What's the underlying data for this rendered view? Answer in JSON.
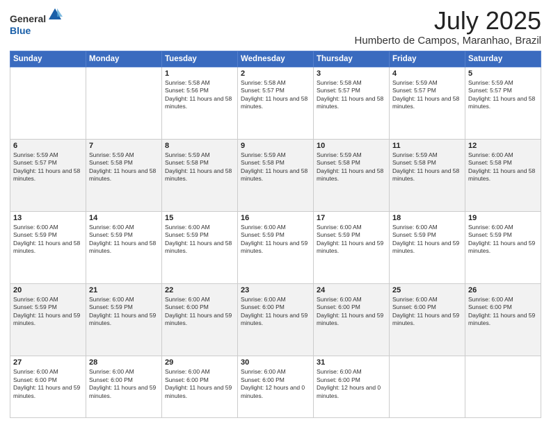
{
  "header": {
    "logo_line1": "General",
    "logo_line2": "Blue",
    "month_year": "July 2025",
    "location": "Humberto de Campos, Maranhao, Brazil"
  },
  "weekdays": [
    "Sunday",
    "Monday",
    "Tuesday",
    "Wednesday",
    "Thursday",
    "Friday",
    "Saturday"
  ],
  "weeks": [
    [
      {
        "day": "",
        "detail": ""
      },
      {
        "day": "",
        "detail": ""
      },
      {
        "day": "1",
        "detail": "Sunrise: 5:58 AM\nSunset: 5:56 PM\nDaylight: 11 hours and 58 minutes."
      },
      {
        "day": "2",
        "detail": "Sunrise: 5:58 AM\nSunset: 5:57 PM\nDaylight: 11 hours and 58 minutes."
      },
      {
        "day": "3",
        "detail": "Sunrise: 5:58 AM\nSunset: 5:57 PM\nDaylight: 11 hours and 58 minutes."
      },
      {
        "day": "4",
        "detail": "Sunrise: 5:59 AM\nSunset: 5:57 PM\nDaylight: 11 hours and 58 minutes."
      },
      {
        "day": "5",
        "detail": "Sunrise: 5:59 AM\nSunset: 5:57 PM\nDaylight: 11 hours and 58 minutes."
      }
    ],
    [
      {
        "day": "6",
        "detail": "Sunrise: 5:59 AM\nSunset: 5:57 PM\nDaylight: 11 hours and 58 minutes."
      },
      {
        "day": "7",
        "detail": "Sunrise: 5:59 AM\nSunset: 5:58 PM\nDaylight: 11 hours and 58 minutes."
      },
      {
        "day": "8",
        "detail": "Sunrise: 5:59 AM\nSunset: 5:58 PM\nDaylight: 11 hours and 58 minutes."
      },
      {
        "day": "9",
        "detail": "Sunrise: 5:59 AM\nSunset: 5:58 PM\nDaylight: 11 hours and 58 minutes."
      },
      {
        "day": "10",
        "detail": "Sunrise: 5:59 AM\nSunset: 5:58 PM\nDaylight: 11 hours and 58 minutes."
      },
      {
        "day": "11",
        "detail": "Sunrise: 5:59 AM\nSunset: 5:58 PM\nDaylight: 11 hours and 58 minutes."
      },
      {
        "day": "12",
        "detail": "Sunrise: 6:00 AM\nSunset: 5:58 PM\nDaylight: 11 hours and 58 minutes."
      }
    ],
    [
      {
        "day": "13",
        "detail": "Sunrise: 6:00 AM\nSunset: 5:59 PM\nDaylight: 11 hours and 58 minutes."
      },
      {
        "day": "14",
        "detail": "Sunrise: 6:00 AM\nSunset: 5:59 PM\nDaylight: 11 hours and 58 minutes."
      },
      {
        "day": "15",
        "detail": "Sunrise: 6:00 AM\nSunset: 5:59 PM\nDaylight: 11 hours and 58 minutes."
      },
      {
        "day": "16",
        "detail": "Sunrise: 6:00 AM\nSunset: 5:59 PM\nDaylight: 11 hours and 59 minutes."
      },
      {
        "day": "17",
        "detail": "Sunrise: 6:00 AM\nSunset: 5:59 PM\nDaylight: 11 hours and 59 minutes."
      },
      {
        "day": "18",
        "detail": "Sunrise: 6:00 AM\nSunset: 5:59 PM\nDaylight: 11 hours and 59 minutes."
      },
      {
        "day": "19",
        "detail": "Sunrise: 6:00 AM\nSunset: 5:59 PM\nDaylight: 11 hours and 59 minutes."
      }
    ],
    [
      {
        "day": "20",
        "detail": "Sunrise: 6:00 AM\nSunset: 5:59 PM\nDaylight: 11 hours and 59 minutes."
      },
      {
        "day": "21",
        "detail": "Sunrise: 6:00 AM\nSunset: 5:59 PM\nDaylight: 11 hours and 59 minutes."
      },
      {
        "day": "22",
        "detail": "Sunrise: 6:00 AM\nSunset: 6:00 PM\nDaylight: 11 hours and 59 minutes."
      },
      {
        "day": "23",
        "detail": "Sunrise: 6:00 AM\nSunset: 6:00 PM\nDaylight: 11 hours and 59 minutes."
      },
      {
        "day": "24",
        "detail": "Sunrise: 6:00 AM\nSunset: 6:00 PM\nDaylight: 11 hours and 59 minutes."
      },
      {
        "day": "25",
        "detail": "Sunrise: 6:00 AM\nSunset: 6:00 PM\nDaylight: 11 hours and 59 minutes."
      },
      {
        "day": "26",
        "detail": "Sunrise: 6:00 AM\nSunset: 6:00 PM\nDaylight: 11 hours and 59 minutes."
      }
    ],
    [
      {
        "day": "27",
        "detail": "Sunrise: 6:00 AM\nSunset: 6:00 PM\nDaylight: 11 hours and 59 minutes."
      },
      {
        "day": "28",
        "detail": "Sunrise: 6:00 AM\nSunset: 6:00 PM\nDaylight: 11 hours and 59 minutes."
      },
      {
        "day": "29",
        "detail": "Sunrise: 6:00 AM\nSunset: 6:00 PM\nDaylight: 11 hours and 59 minutes."
      },
      {
        "day": "30",
        "detail": "Sunrise: 6:00 AM\nSunset: 6:00 PM\nDaylight: 12 hours and 0 minutes."
      },
      {
        "day": "31",
        "detail": "Sunrise: 6:00 AM\nSunset: 6:00 PM\nDaylight: 12 hours and 0 minutes."
      },
      {
        "day": "",
        "detail": ""
      },
      {
        "day": "",
        "detail": ""
      }
    ]
  ]
}
